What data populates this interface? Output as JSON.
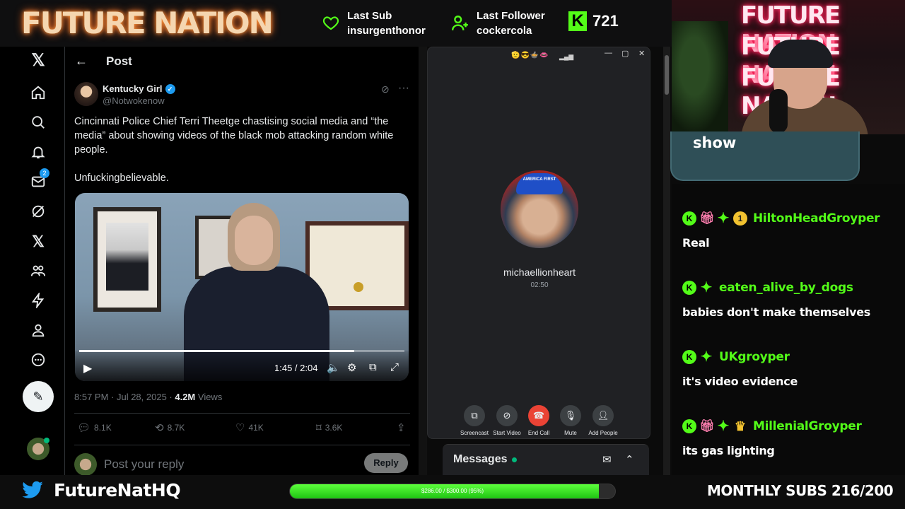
{
  "stream": {
    "brand": "FUTURE NATION",
    "last_sub_label": "Last Sub",
    "last_sub_name": "insurgenthonor",
    "last_follower_label": "Last Follower",
    "last_follower_name": "cockercola",
    "kick_letter": "K",
    "kick_count": "721",
    "show_label": "show",
    "twitter_handle": "FutureNatHQ",
    "goal_text": "$286.00 / $300.00 (95%)",
    "goal_fraction": 0.95,
    "monthly_subs": "MONTHLY SUBS 216/200",
    "accent_color": "#53fc18"
  },
  "x_app": {
    "header_title": "Post",
    "nav_icons": [
      "x-logo-icon",
      "home-icon",
      "search-icon",
      "bell-icon",
      "mail-icon",
      "grok-icon",
      "x-premium-icon",
      "communities-icon",
      "lightning-icon",
      "profile-icon",
      "more-circle-icon"
    ],
    "mail_badge": "2",
    "post": {
      "author": "Kentucky Girl",
      "handle": "@Notwokenow",
      "text": "Cincinnati Police Chief Terri Theetge chastising social media and “the media” about showing videos of the black mob attacking random white people.\n\nUnfuckingbelievable.",
      "video_time": "1:45 / 2:04",
      "video_progress": 0.846,
      "timestamp": "8:57 PM · Jul 28, 2025 · ",
      "views_count": "4.2M",
      "views_label": " Views",
      "replies": "8.1K",
      "reposts": "8.7K",
      "likes": "41K",
      "bookmarks": "3.6K"
    },
    "reply_placeholder": "Post your reply",
    "reply_button": "Reply",
    "messages_title": "Messages"
  },
  "call": {
    "emojis": "🫡😎🍲👄",
    "caller_name": "michaellionheart",
    "duration": "02:50",
    "cap_text": "AMERICA FIRST",
    "buttons": [
      "Screencast",
      "Start Video",
      "End Call",
      "Mute",
      "Add People"
    ]
  },
  "chat": [
    {
      "user": "HiltonHeadGroyper",
      "badges": [
        "kick",
        "gift",
        "gem",
        "one"
      ],
      "text": "Real"
    },
    {
      "user": "eaten_alive_by_dogs",
      "badges": [
        "kick",
        "gem"
      ],
      "text": "babies don't make themselves"
    },
    {
      "user": "UKgroyper",
      "badges": [
        "kick",
        "gem"
      ],
      "text": "it's video evidence"
    },
    {
      "user": "MillenialGroyper",
      "badges": [
        "kick",
        "gift",
        "gem",
        "crown"
      ],
      "text": "its gas lighting"
    }
  ]
}
